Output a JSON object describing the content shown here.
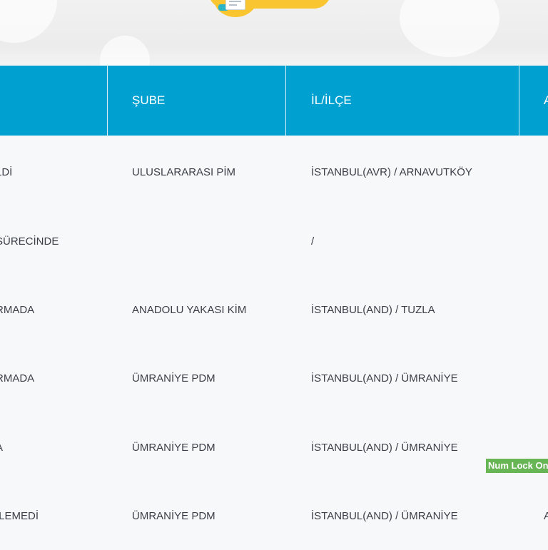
{
  "table": {
    "headers": [
      "",
      "ŞUBE",
      "İL/İLÇE",
      "A"
    ],
    "rows": [
      {
        "status": "LDİ",
        "sube": "ULUSLARARASI PİM",
        "il_ilce": "İSTANBUL(AVR) / ARNAVUTKÖY",
        "extra": ""
      },
      {
        "status": "SÜRECİNDE",
        "sube": "",
        "il_ilce": "/",
        "extra": ""
      },
      {
        "status": "RMADA",
        "sube": "ANADOLU YAKASI KİM",
        "il_ilce": "İSTANBUL(AND) / TUZLA",
        "extra": ""
      },
      {
        "status": "RMADA",
        "sube": "ÜMRANİYE PDM",
        "il_ilce": "İSTANBUL(AND) / ÜMRANİYE",
        "extra": ""
      },
      {
        "status": "A",
        "sube": "ÜMRANİYE PDM",
        "il_ilce": "İSTANBUL(AND) / ÜMRANİYE",
        "extra": ""
      },
      {
        "status": "İLEMEDİ",
        "sube": "ÜMRANİYE PDM",
        "il_ilce": "İSTANBUL(AND) / ÜMRANİYE",
        "extra": "A"
      }
    ]
  },
  "overlay": {
    "numlock": "Num Lock On"
  },
  "colors": {
    "header_bg": "#00a0d1",
    "badge": "#f9c632",
    "numlock_bg": "#68b556"
  },
  "icons": {
    "banner": "document-illustration-icon"
  }
}
